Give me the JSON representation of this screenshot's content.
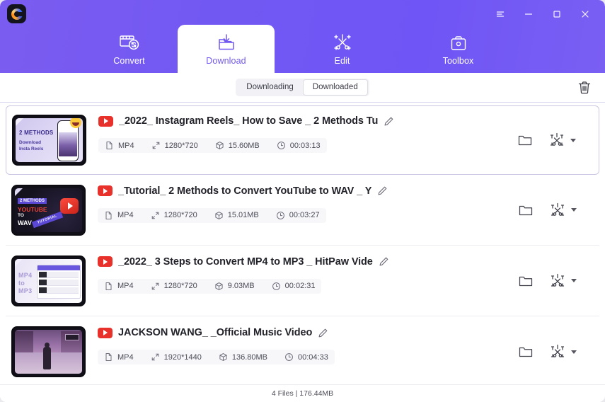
{
  "window": {
    "logo_icon": "hitpaw-c-logo",
    "controls": [
      {
        "name": "menu-button",
        "icon": "hamburger-menu-icon"
      },
      {
        "name": "minimize-button",
        "icon": "minimize-icon"
      },
      {
        "name": "maximize-button",
        "icon": "maximize-icon"
      },
      {
        "name": "close-button",
        "icon": "close-icon"
      }
    ]
  },
  "tabs": [
    {
      "label": "Convert",
      "icon": "film-convert-icon",
      "active": false
    },
    {
      "label": "Download",
      "icon": "download-folder-icon",
      "active": true
    },
    {
      "label": "Edit",
      "icon": "scissors-crop-icon",
      "active": false
    },
    {
      "label": "Toolbox",
      "icon": "toolbox-icon",
      "active": false
    }
  ],
  "subbar": {
    "segments": [
      {
        "label": "Downloading",
        "active": false
      },
      {
        "label": "Downloaded",
        "active": true
      }
    ],
    "delete_icon": "trash-icon"
  },
  "meta_labels": {
    "format_icon": "file-icon",
    "resolution_icon": "resize-icon",
    "size_icon": "box-icon",
    "duration_icon": "clock-icon"
  },
  "row_actions": {
    "folder_icon": "folder-icon",
    "edit_icon": "scissors-crop-icon",
    "dropdown_icon": "chevron-down-icon",
    "rename_icon": "pencil-icon",
    "source_badge": "youtube-icon"
  },
  "items": [
    {
      "title": "_2022_ Instagram Reels_ How to Save _ 2 Methods Tu",
      "format": "MP4",
      "resolution": "1280*720",
      "size": "15.60MB",
      "duration": "00:03:13",
      "selected": true
    },
    {
      "title": "_Tutorial_ 2 Methods to Convert YouTube to WAV _ Y",
      "format": "MP4",
      "resolution": "1280*720",
      "size": "15.01MB",
      "duration": "00:03:27",
      "selected": false
    },
    {
      "title": "_2022_ 3 Steps to Convert MP4 to MP3 _ HitPaw Vide",
      "format": "MP4",
      "resolution": "1280*720",
      "size": "9.03MB",
      "duration": "00:02:31",
      "selected": false
    },
    {
      "title": "JACKSON WANG_ _Official Music Video",
      "format": "MP4",
      "resolution": "1920*1440",
      "size": "136.80MB",
      "duration": "00:04:33",
      "selected": false
    }
  ],
  "status": {
    "text": "4 Files | 176.44MB"
  },
  "colors": {
    "brand_purple": "#7158f0",
    "header_gradient_start": "#7b5cf0",
    "header_gradient_end": "#6f55f5",
    "youtube_red": "#e8312a",
    "selected_border": "#cdc7e6"
  }
}
